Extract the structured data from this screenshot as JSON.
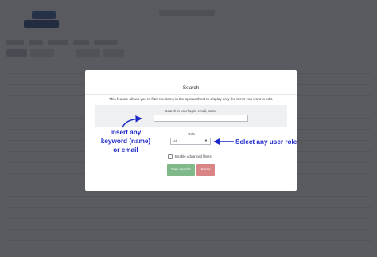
{
  "modal": {
    "title": "Search",
    "description": "This feature allows you to filter the items in the spreadsheet to display only the items you want to edit.",
    "search_label": "Search in user login, email, name",
    "search_value": "",
    "role_label": "Role",
    "role_value": "All",
    "advanced_filters_label": "Enable advanced filters",
    "advanced_filters_checked": false,
    "run_search_label": "Run search",
    "close_label": "Close"
  },
  "annotations": {
    "left_text_line1": "Insert any",
    "left_text_line2": "keyword (name)",
    "left_text_line3": "or email",
    "right_text": "Select any user role",
    "color": "#1d28c8"
  },
  "colors": {
    "run_button": "#7fb98a",
    "close_button": "#d98585"
  }
}
